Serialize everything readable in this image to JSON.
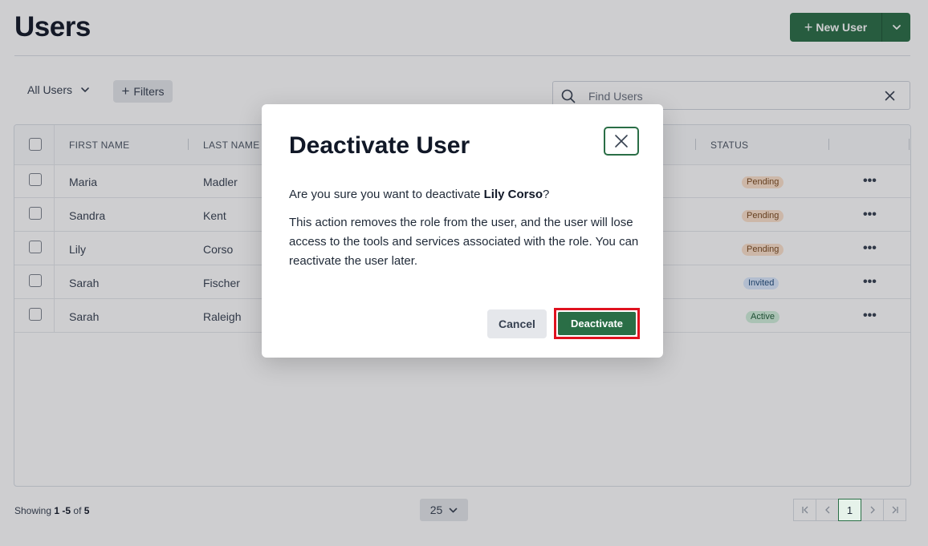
{
  "page": {
    "title": "Users"
  },
  "header": {
    "new_user_label": "New User",
    "new_user_plus": "+"
  },
  "toolbar": {
    "view_select": "All Users",
    "filters_label": "Filters",
    "filters_plus": "+"
  },
  "search": {
    "placeholder": "Find Users",
    "value": ""
  },
  "table": {
    "columns": {
      "first_name": "FIRST NAME",
      "last_name": "LAST NAME",
      "status": "STATUS"
    },
    "rows": [
      {
        "first": "Maria",
        "last": "Madler",
        "status": "Pending",
        "more": "•••"
      },
      {
        "first": "Sandra",
        "last": "Kent",
        "status": "Pending",
        "more": "•••"
      },
      {
        "first": "Lily",
        "last": "Corso",
        "status": "Pending",
        "more": "•••"
      },
      {
        "first": "Sarah",
        "last": "Fischer",
        "status": "Invited",
        "more": "•••"
      },
      {
        "first": "Sarah",
        "last": "Raleigh",
        "status": "Active",
        "more": "•••"
      }
    ]
  },
  "footer": {
    "showing_prefix": "Showing",
    "showing_range": "1 -5",
    "showing_of": "of",
    "showing_total": "5",
    "per_page": "25",
    "pager": {
      "first": "K",
      "prev": "‹",
      "current": "1",
      "next": "›",
      "last": "›|"
    }
  },
  "modal": {
    "title": "Deactivate User",
    "question_prefix": "Are you sure you want to deactivate ",
    "user_name": "Lily Corso",
    "question_suffix": "?",
    "description": "This action removes the role from the user, and the user will lose access to the tools and services associated with the role. You can reactivate the user later.",
    "cancel_label": "Cancel",
    "confirm_label": "Deactivate"
  },
  "colors": {
    "primary": "#2a6e46",
    "highlight": "#e0121f",
    "pending_bg": "#fde2cc",
    "invited_bg": "#dbeafe",
    "active_bg": "#d1f0dc"
  }
}
